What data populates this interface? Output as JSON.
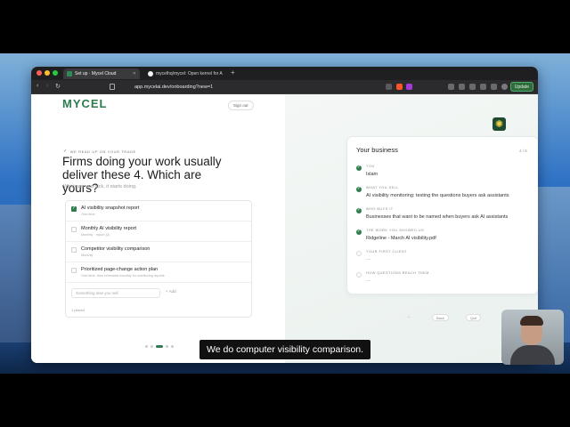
{
  "browser": {
    "tabs": [
      {
        "label": "Set up · Mycel Cloud",
        "active": true
      },
      {
        "label": "mycelhq/mycel: Open kernel for A",
        "active": false
      }
    ],
    "url": "app.mycelai.dev/onboarding?new=1",
    "update_label": "Update"
  },
  "header": {
    "logo": "MYCEL",
    "signout_label": "Sign out"
  },
  "intro": {
    "eyebrow": "WE READ UP ON YOUR TRADE",
    "headline": "Firms doing your work usually deliver these 4. Which are yours?",
    "subhead": "Whatever you pick, it starts doing."
  },
  "offerings": [
    {
      "title": "AI visibility snapshot report",
      "meta": "One-time",
      "checked": true
    },
    {
      "title": "Monthly AI visibility report",
      "meta": "Monthly · report (2)",
      "checked": false
    },
    {
      "title": "Competitor visibility comparison",
      "meta": "Monthly",
      "checked": false
    },
    {
      "title": "Prioritized page-change action plan",
      "meta": "One-time, then refreshed monthly for monitoring reports",
      "checked": false
    }
  ],
  "custom": {
    "placeholder": "Something else you sell",
    "add_label": "+ Add"
  },
  "picked_count": "1 picked",
  "business_card": {
    "title": "Your business",
    "count": "4 / 6",
    "facts": [
      {
        "label": "YOU",
        "value": "Islam",
        "done": true
      },
      {
        "label": "WHAT YOU SELL",
        "value": "AI visibility monitoring: testing the questions buyers ask assistants",
        "done": true
      },
      {
        "label": "WHO BUYS IT",
        "value": "Businesses that want to be named when buyers ask AI assistants",
        "done": true
      },
      {
        "label": "THE WORK YOU SHOWED US",
        "value": "Ridgeline - March AI visibility.pdf",
        "done": true
      },
      {
        "label": "YOUR FIRST CLIENT",
        "value": "—",
        "done": false
      },
      {
        "label": "HOW QUESTIONS REACH THEM",
        "value": "—",
        "done": false
      }
    ]
  },
  "pager": {
    "prev": "←",
    "back": "Back",
    "exit": "Quit"
  },
  "caption": "We do computer visibility comparison.",
  "colors": {
    "brand": "#2e7d4f",
    "widget": "#1f4a32"
  },
  "icons": {
    "side_widget": "sparkle-icon"
  }
}
